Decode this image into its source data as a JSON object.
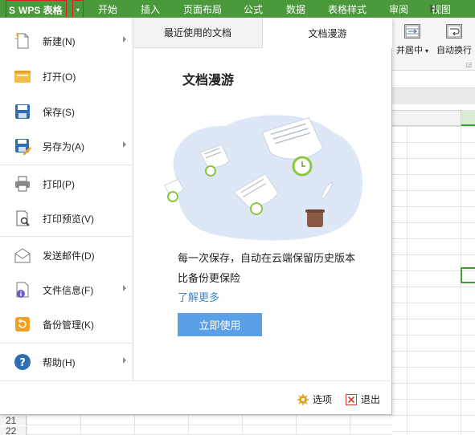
{
  "menubar": {
    "app_button_logo": "S",
    "app_button_label": "WPS 表格",
    "dropdown_glyph": "▾",
    "tabs": [
      "开始",
      "插入",
      "页面布局",
      "公式",
      "数据",
      "表格样式",
      "审阅",
      "视图"
    ]
  },
  "ribbon": {
    "merge_label": "并居中",
    "merge_arrow": "▾",
    "wrap_label": "自动换行",
    "launcher_glyph": "◲"
  },
  "sheet": {
    "column_h": "H",
    "row_21": "21",
    "row_22": "22"
  },
  "menu": {
    "items": [
      {
        "label": "新建(N)",
        "icon": "new-file-icon"
      },
      {
        "label": "打开(O)",
        "icon": "open-folder-icon"
      },
      {
        "label": "保存(S)",
        "icon": "save-icon"
      },
      {
        "label": "另存为(A)",
        "icon": "save-as-icon"
      },
      {
        "label": "打印(P)",
        "icon": "print-icon"
      },
      {
        "label": "打印预览(V)",
        "icon": "print-preview-icon"
      },
      {
        "label": "发送邮件(D)",
        "icon": "mail-icon"
      },
      {
        "label": "文件信息(F)",
        "icon": "file-info-icon"
      },
      {
        "label": "备份管理(K)",
        "icon": "backup-icon"
      },
      {
        "label": "帮助(H)",
        "icon": "help-icon"
      }
    ]
  },
  "panel": {
    "tabs": {
      "recent": "最近使用的文档",
      "roaming": "文档漫游"
    },
    "title": "文档漫游",
    "desc_line1": "每一次保存，自动在云端保留历史版本",
    "desc_line2": "比备份更保险",
    "learn_more": "了解更多",
    "use_button": "立即使用",
    "options": "选项",
    "exit": "退出"
  },
  "colors": {
    "menubar_green": "#4a9a3c",
    "highlight_red": "#d9202a",
    "link_blue": "#3b87d6",
    "button_blue": "#5aa0e6",
    "illustration_bg": "#dde7f6",
    "clock_green": "#8dc63f"
  }
}
